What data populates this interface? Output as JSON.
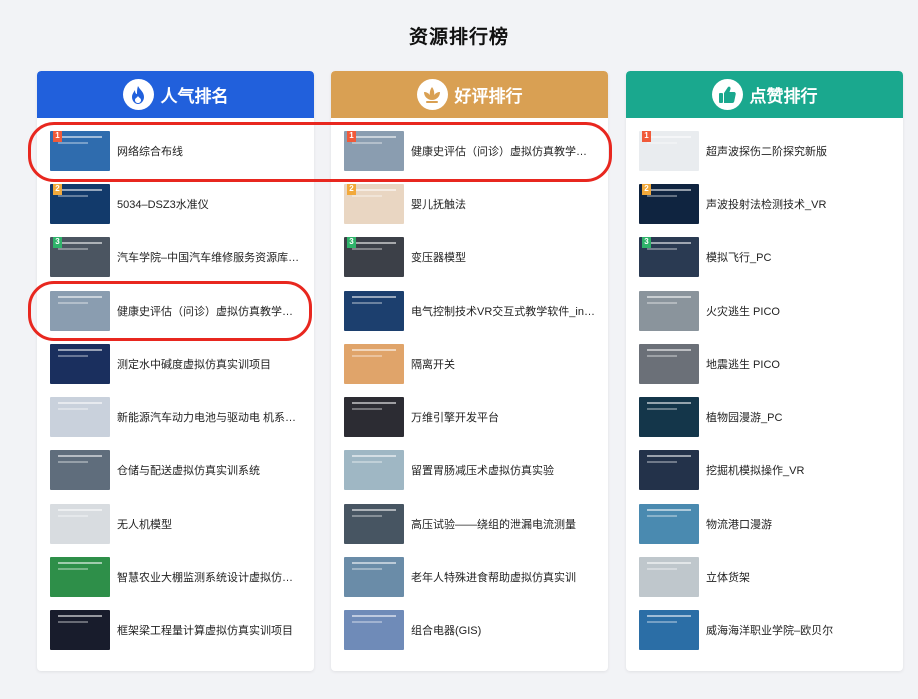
{
  "page": {
    "title": "资源排行榜"
  },
  "columns": [
    {
      "title": "人气排名",
      "icon": "flame-icon",
      "color": "#2160dc",
      "items": [
        {
          "rank": "1",
          "title": "网络综合布线",
          "thumb": "#2f6cae"
        },
        {
          "rank": "2",
          "title": "5034–DSZ3水准仪",
          "thumb": "#123a6b"
        },
        {
          "rank": "3",
          "title": "汽车学院–中国汽车维修服务资源库–…",
          "thumb": "#4b5561"
        },
        {
          "rank": "",
          "title": "健康史评估（问诊）虚拟仿真教学系统",
          "thumb": "#8a9db0"
        },
        {
          "rank": "",
          "title": "测定水中碱度虚拟仿真实训项目",
          "thumb": "#1a2f5e"
        },
        {
          "rank": "",
          "title": "新能源汽车动力电池与驱动电 机系…",
          "thumb": "#c9d1dc"
        },
        {
          "rank": "",
          "title": "仓储与配送虚拟仿真实训系统",
          "thumb": "#5f6d7c"
        },
        {
          "rank": "",
          "title": "无人机模型",
          "thumb": "#d8dce0"
        },
        {
          "rank": "",
          "title": "智慧农业大棚监测系统设计虚拟仿真…",
          "thumb": "#2e8f49"
        },
        {
          "rank": "",
          "title": "框架梁工程量计算虚拟仿真实训项目",
          "thumb": "#181c2c"
        }
      ]
    },
    {
      "title": "好评排行",
      "icon": "lotus-icon",
      "color": "#d9a053",
      "items": [
        {
          "rank": "1",
          "title": "健康史评估（问诊）虚拟仿真教学系统",
          "thumb": "#8a9db0"
        },
        {
          "rank": "2",
          "title": "婴儿抚触法",
          "thumb": "#e9d6c2"
        },
        {
          "rank": "3",
          "title": "变压器模型",
          "thumb": "#3c4048"
        },
        {
          "rank": "",
          "title": "电气控制技术VR交互式教学软件_inS…",
          "thumb": "#1c3f6e"
        },
        {
          "rank": "",
          "title": "隔离开关",
          "thumb": "#e0a46a"
        },
        {
          "rank": "",
          "title": "万维引擎开发平台",
          "thumb": "#2c2c33"
        },
        {
          "rank": "",
          "title": "留置胃肠减压术虚拟仿真实验",
          "thumb": "#9fb7c4"
        },
        {
          "rank": "",
          "title": "高压试验——绕组的泄漏电流测量",
          "thumb": "#475562"
        },
        {
          "rank": "",
          "title": "老年人特殊进食帮助虚拟仿真实训",
          "thumb": "#6a8ca8"
        },
        {
          "rank": "",
          "title": "组合电器(GIS)",
          "thumb": "#6f8bb8"
        }
      ]
    },
    {
      "title": "点赞排行",
      "icon": "thumbs-up-icon",
      "color": "#1aa88e",
      "items": [
        {
          "rank": "1",
          "title": "超声波探伤二阶探究新版",
          "thumb": "#e9ecef"
        },
        {
          "rank": "2",
          "title": "声波投射法检测技术_VR",
          "thumb": "#0f2440"
        },
        {
          "rank": "3",
          "title": "模拟飞行_PC",
          "thumb": "#2a3a52"
        },
        {
          "rank": "",
          "title": "火灾逃生 PICO",
          "thumb": "#8a949c"
        },
        {
          "rank": "",
          "title": "地震逃生 PICO",
          "thumb": "#6b7078"
        },
        {
          "rank": "",
          "title": "植物园漫游_PC",
          "thumb": "#14364a"
        },
        {
          "rank": "",
          "title": "挖掘机模拟操作_VR",
          "thumb": "#23324a"
        },
        {
          "rank": "",
          "title": "物流港口漫游",
          "thumb": "#4a8ab0"
        },
        {
          "rank": "",
          "title": "立体货架",
          "thumb": "#bfc7cc"
        },
        {
          "rank": "",
          "title": "威海海洋职业学院–欧贝尔",
          "thumb": "#2b6ea6"
        }
      ]
    }
  ]
}
